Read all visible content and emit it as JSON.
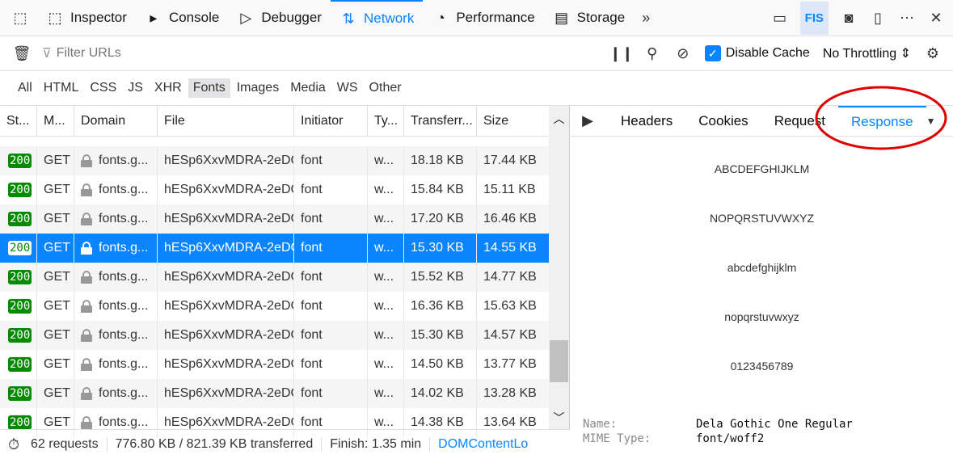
{
  "toolbar": {
    "tabs": [
      {
        "label": "Inspector",
        "icon": "inspector-icon"
      },
      {
        "label": "Console",
        "icon": "console-icon"
      },
      {
        "label": "Debugger",
        "icon": "debugger-icon"
      },
      {
        "label": "Network",
        "icon": "network-icon",
        "active": true
      },
      {
        "label": "Performance",
        "icon": "performance-icon"
      },
      {
        "label": "Storage",
        "icon": "storage-icon"
      }
    ],
    "fis": "FIS"
  },
  "filter": {
    "placeholder": "Filter URLs",
    "disable_cache": "Disable Cache",
    "disable_cache_checked": true,
    "throttling": "No Throttling"
  },
  "types": [
    "All",
    "HTML",
    "CSS",
    "JS",
    "XHR",
    "Fonts",
    "Images",
    "Media",
    "WS",
    "Other"
  ],
  "active_type": "Fonts",
  "columns": [
    "St...",
    "M...",
    "Domain",
    "File",
    "Initiator",
    "Ty...",
    "Transferr...",
    "Size"
  ],
  "rows": [
    [
      "200",
      "GET",
      "fonts.g...",
      "hESp6XxvMDRA-2eDC",
      "font",
      "w...",
      "18.18 KB",
      "17.44 KB"
    ],
    [
      "200",
      "GET",
      "fonts.g...",
      "hESp6XxvMDRA-2eDC",
      "font",
      "w...",
      "15.84 KB",
      "15.11 KB"
    ],
    [
      "200",
      "GET",
      "fonts.g...",
      "hESp6XxvMDRA-2eDC",
      "font",
      "w...",
      "17.20 KB",
      "16.46 KB"
    ],
    [
      "200",
      "GET",
      "fonts.g...",
      "hESp6XxvMDRA-2eDC",
      "font",
      "w...",
      "15.30 KB",
      "14.55 KB"
    ],
    [
      "200",
      "GET",
      "fonts.g...",
      "hESp6XxvMDRA-2eDC",
      "font",
      "w...",
      "15.52 KB",
      "14.77 KB"
    ],
    [
      "200",
      "GET",
      "fonts.g...",
      "hESp6XxvMDRA-2eDC",
      "font",
      "w...",
      "16.36 KB",
      "15.63 KB"
    ],
    [
      "200",
      "GET",
      "fonts.g...",
      "hESp6XxvMDRA-2eDC",
      "font",
      "w...",
      "15.30 KB",
      "14.57 KB"
    ],
    [
      "200",
      "GET",
      "fonts.g...",
      "hESp6XxvMDRA-2eDC",
      "font",
      "w...",
      "14.50 KB",
      "13.77 KB"
    ],
    [
      "200",
      "GET",
      "fonts.g...",
      "hESp6XxvMDRA-2eDC",
      "font",
      "w...",
      "14.02 KB",
      "13.28 KB"
    ],
    [
      "200",
      "GET",
      "fonts.g...",
      "hESp6XxvMDRA-2eDC",
      "font",
      "w...",
      "14.38 KB",
      "13.64 KB"
    ]
  ],
  "selected_row": 3,
  "status": {
    "requests": "62 requests",
    "transferred": "776.80 KB / 821.39 KB transferred",
    "finish": "Finish: 1.35 min",
    "dcl": "DOMContentLo"
  },
  "detail": {
    "tabs": [
      "Headers",
      "Cookies",
      "Request",
      "Response"
    ],
    "active": "Response",
    "preview": [
      "ABCDEFGHIJKLM",
      "NOPQRSTUVWXYZ",
      "abcdefghijklm",
      "nopqrstuvwxyz",
      "0123456789"
    ],
    "name_label": "Name:",
    "name": "Dela Gothic One Regular",
    "mime_label": "MIME Type:",
    "mime": "font/woff2"
  },
  "annotation_color": "#e00000"
}
